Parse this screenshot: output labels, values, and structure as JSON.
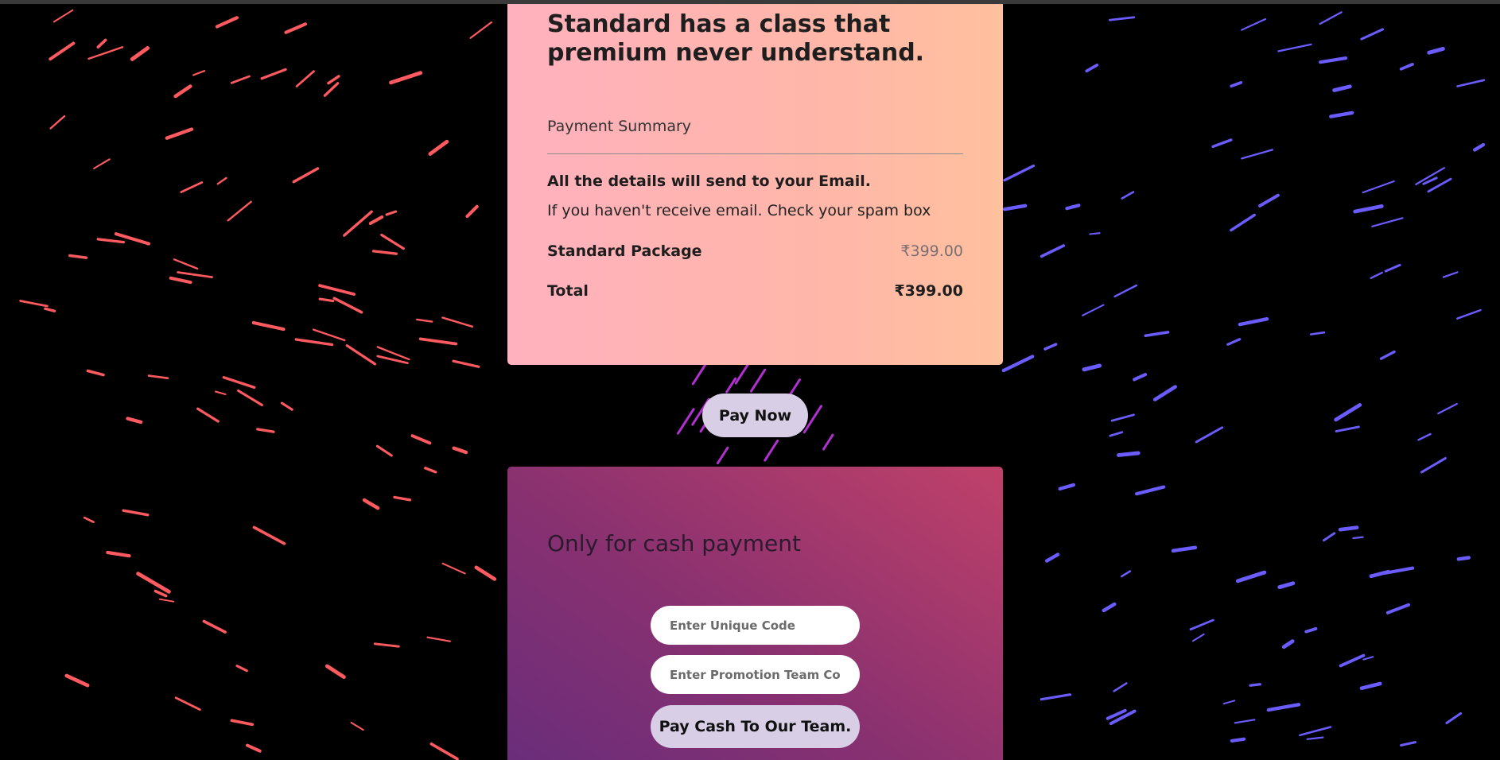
{
  "summary_card": {
    "headline": "Standard has a class that premium never understand.",
    "section_label": "Payment Summary",
    "email_note": "All the details will send to your Email.",
    "spam_note": "If you haven't receive email. Check your spam box",
    "package_label": "Standard Package",
    "package_price": "₹399.00",
    "total_label": "Total",
    "total_price": "₹399.00"
  },
  "pay_now_label": "Pay Now",
  "cash_card": {
    "title": "Only for cash payment",
    "unique_code_placeholder": "Enter Unique Code",
    "promo_code_placeholder": "Enter Promotion Team Code",
    "pay_cash_label": "Pay Cash To Our Team."
  },
  "colors": {
    "background": "#000000",
    "summary_gradient_start": "#ffb1be",
    "summary_gradient_end": "#ffc09e",
    "cash_gradient_start": "#6a2d7a",
    "cash_gradient_end": "#c04169",
    "button": "#d8cfe6",
    "streak_red": "#ff5a5f",
    "streak_blue": "#6b5cff",
    "streak_magenta": "#b030d0"
  }
}
